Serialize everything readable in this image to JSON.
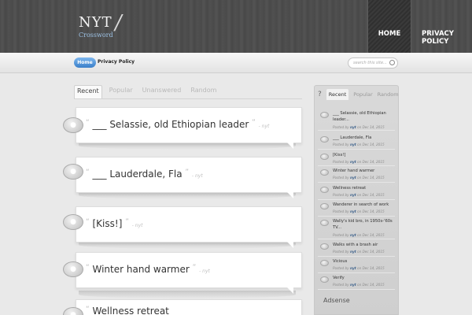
{
  "header": {
    "logo_main": "NYT",
    "logo_sub": "Crossword",
    "nav": [
      "HOME",
      "PRIVACY POLICY"
    ]
  },
  "breadcrumb": {
    "home": "Home",
    "current": "Privacy Policy"
  },
  "search": {
    "placeholder": "search this site..."
  },
  "tabs": [
    "Recent",
    "Popular",
    "Unanswered",
    "Random"
  ],
  "posts": [
    {
      "title": "___ Selassie, old Ethiopian leader",
      "author": "- nyt"
    },
    {
      "title": "___ Lauderdale, Fla",
      "author": "- nyt"
    },
    {
      "title": "[Kiss!]",
      "author": "- nyt"
    },
    {
      "title": "Winter hand warmer",
      "author": "- nyt"
    },
    {
      "title": "Wellness retreat",
      "author": ""
    }
  ],
  "sidebar": {
    "tabs": [
      "Recent",
      "Popular",
      "Random"
    ],
    "items": [
      {
        "title": "___ Selassie, old Ethiopian leader...",
        "posted_by": "Posted by",
        "author": "nyt",
        "on": "on Dec 14, 2015"
      },
      {
        "title": "___ Lauderdale, Fla",
        "posted_by": "Posted by",
        "author": "nyt",
        "on": "on Dec 14, 2015"
      },
      {
        "title": "[Kiss!]",
        "posted_by": "Posted by",
        "author": "nyt",
        "on": "on Dec 14, 2015"
      },
      {
        "title": "Winter hand warmer",
        "posted_by": "Posted by",
        "author": "nyt",
        "on": "on Dec 14, 2015"
      },
      {
        "title": "Wellness retreat",
        "posted_by": "Posted by",
        "author": "nyt",
        "on": "on Dec 14, 2015"
      },
      {
        "title": "Wanderer in search of work",
        "posted_by": "Posted by",
        "author": "nyt",
        "on": "on Dec 14, 2015"
      },
      {
        "title": "Wally's kid bro, in 1950s-'60s TV...",
        "posted_by": "Posted by",
        "author": "nyt",
        "on": "on Dec 14, 2015"
      },
      {
        "title": "Walks with a brash air",
        "posted_by": "Posted by",
        "author": "nyt",
        "on": "on Dec 14, 2015"
      },
      {
        "title": "Vicious",
        "posted_by": "Posted by",
        "author": "nyt",
        "on": "on Dec 14, 2015"
      },
      {
        "title": "Verify",
        "posted_by": "Posted by",
        "author": "nyt",
        "on": "on Dec 14, 2015"
      }
    ],
    "adsense": "Adsense"
  },
  "colors": {
    "accent": "#3a7fc9",
    "header_bg": "#4b4b4b"
  }
}
